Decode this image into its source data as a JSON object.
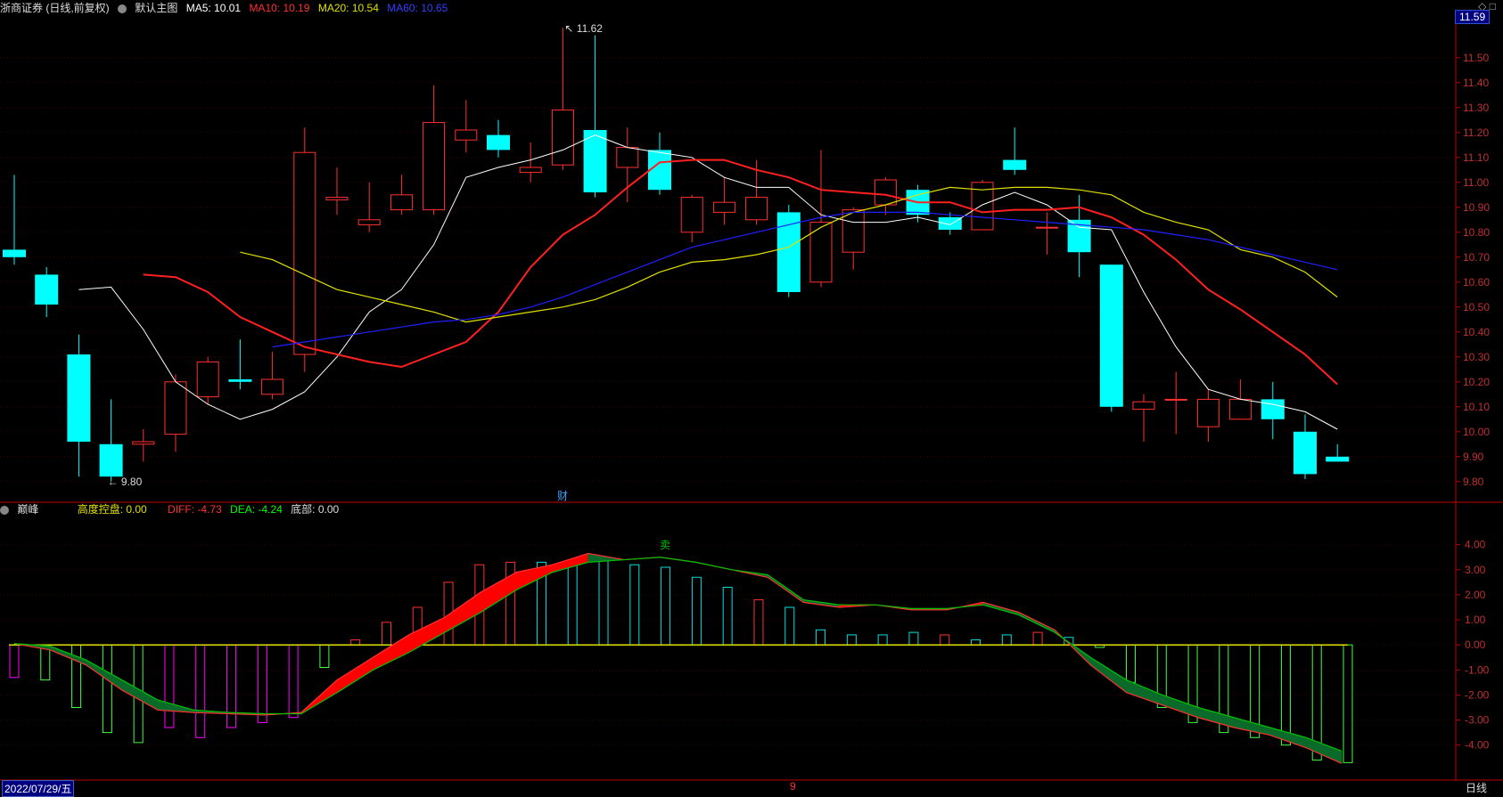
{
  "header": {
    "stock": "浙商证券 (日线,前复权)",
    "gear1": "gear-icon",
    "template": "默认主图",
    "ma5": "MA5: 10.01",
    "ma10": "MA10: 10.19",
    "ma20": "MA20: 10.54",
    "ma60": "MA60: 10.65"
  },
  "indicator_header": {
    "name": "巅峰",
    "gkp": "高度控盘: 0.00",
    "diff": "DIFF: -4.73",
    "dea": "DEA: -4.24",
    "bottom": "底部: 0.00"
  },
  "footer": {
    "date": "2022/07/29/五",
    "month_mark": "9",
    "period": "日线"
  },
  "annotations": {
    "high": "11.62",
    "low": "9.80",
    "cai": "财",
    "mai": "卖"
  },
  "price_badge": "11.59",
  "colors": {
    "up": "#ff3030",
    "down": "#00ffff",
    "ma5": "#ffffff",
    "ma10": "#ff2020",
    "ma20": "#e0e000",
    "ma60": "#2020ff",
    "diff": "#ff3030",
    "dea": "#00c000",
    "fill_up": "#ff0000",
    "fill_down": "#0a6a2a",
    "axis": "#c00000"
  },
  "chart_data": [
    {
      "type": "candlestick",
      "yticks": [
        "11.50",
        "11.40",
        "11.30",
        "11.20",
        "11.10",
        "11.00",
        "10.90",
        "10.80",
        "10.70",
        "10.60",
        "10.50",
        "10.40",
        "10.30",
        "10.20",
        "10.10",
        "10.00",
        "9.90",
        "9.80"
      ],
      "ylim": [
        9.76,
        11.66
      ],
      "candles": [
        {
          "o": 10.73,
          "c": 10.7,
          "h": 11.03,
          "l": 10.67
        },
        {
          "o": 10.63,
          "c": 10.51,
          "h": 10.66,
          "l": 10.46
        },
        {
          "o": 10.31,
          "c": 9.96,
          "h": 10.39,
          "l": 9.82
        },
        {
          "o": 9.95,
          "c": 9.82,
          "h": 10.13,
          "l": 9.8
        },
        {
          "o": 9.95,
          "c": 9.96,
          "h": 10.01,
          "l": 9.88
        },
        {
          "o": 9.99,
          "c": 10.2,
          "h": 10.23,
          "l": 9.92
        },
        {
          "o": 10.14,
          "c": 10.28,
          "h": 10.3,
          "l": 10.11
        },
        {
          "o": 10.21,
          "c": 10.2,
          "h": 10.37,
          "l": 10.17
        },
        {
          "o": 10.15,
          "c": 10.21,
          "h": 10.32,
          "l": 10.13
        },
        {
          "o": 10.31,
          "c": 11.12,
          "h": 11.22,
          "l": 10.24
        },
        {
          "o": 10.93,
          "c": 10.94,
          "h": 11.06,
          "l": 10.87
        },
        {
          "o": 10.83,
          "c": 10.85,
          "h": 11.0,
          "l": 10.8
        },
        {
          "o": 10.89,
          "c": 10.95,
          "h": 11.03,
          "l": 10.87
        },
        {
          "o": 10.89,
          "c": 11.24,
          "h": 11.39,
          "l": 10.87
        },
        {
          "o": 11.17,
          "c": 11.21,
          "h": 11.33,
          "l": 11.12
        },
        {
          "o": 11.19,
          "c": 11.13,
          "h": 11.25,
          "l": 11.1
        },
        {
          "o": 11.04,
          "c": 11.06,
          "h": 11.16,
          "l": 11.0
        },
        {
          "o": 11.07,
          "c": 11.29,
          "h": 11.62,
          "l": 11.05
        },
        {
          "o": 11.21,
          "c": 10.96,
          "h": 11.59,
          "l": 10.94
        },
        {
          "o": 11.06,
          "c": 11.14,
          "h": 11.22,
          "l": 10.92
        },
        {
          "o": 11.13,
          "c": 10.97,
          "h": 11.2,
          "l": 10.95
        },
        {
          "o": 10.8,
          "c": 10.94,
          "h": 10.95,
          "l": 10.76
        },
        {
          "o": 10.88,
          "c": 10.92,
          "h": 11.02,
          "l": 10.83
        },
        {
          "o": 10.85,
          "c": 10.94,
          "h": 11.09,
          "l": 10.83
        },
        {
          "o": 10.88,
          "c": 10.56,
          "h": 10.91,
          "l": 10.54
        },
        {
          "o": 10.6,
          "c": 10.84,
          "h": 11.13,
          "l": 10.58
        },
        {
          "o": 10.72,
          "c": 10.89,
          "h": 10.9,
          "l": 10.65
        },
        {
          "o": 10.91,
          "c": 11.01,
          "h": 11.02,
          "l": 10.87
        },
        {
          "o": 10.97,
          "c": 10.87,
          "h": 10.99,
          "l": 10.84
        },
        {
          "o": 10.86,
          "c": 10.81,
          "h": 10.88,
          "l": 10.79
        },
        {
          "o": 10.81,
          "c": 11.0,
          "h": 11.01,
          "l": 10.81
        },
        {
          "o": 11.09,
          "c": 11.05,
          "h": 11.22,
          "l": 11.03
        },
        {
          "o": 10.82,
          "c": 10.82,
          "h": 10.88,
          "l": 10.71
        },
        {
          "o": 10.85,
          "c": 10.72,
          "h": 10.95,
          "l": 10.62
        },
        {
          "o": 10.67,
          "c": 10.1,
          "h": 10.67,
          "l": 10.08
        },
        {
          "o": 10.09,
          "c": 10.12,
          "h": 10.15,
          "l": 9.96
        },
        {
          "o": 10.13,
          "c": 10.13,
          "h": 10.24,
          "l": 9.99
        },
        {
          "o": 10.02,
          "c": 10.13,
          "h": 10.17,
          "l": 9.96
        },
        {
          "o": 10.05,
          "c": 10.13,
          "h": 10.21,
          "l": 10.05
        },
        {
          "o": 10.13,
          "c": 10.05,
          "h": 10.2,
          "l": 9.97
        },
        {
          "o": 10.0,
          "c": 9.83,
          "h": 10.07,
          "l": 9.81
        },
        {
          "o": 9.9,
          "c": 9.88,
          "h": 9.95,
          "l": 9.88
        }
      ],
      "series": [
        {
          "name": "MA5",
          "values": [
            10.57,
            10.58,
            10.41,
            10.2,
            10.11,
            10.05,
            10.09,
            10.16,
            10.3,
            10.48,
            10.57,
            10.75,
            11.02,
            11.06,
            11.09,
            11.13,
            11.19,
            11.14,
            11.12,
            11.1,
            11.02,
            10.98,
            10.98,
            10.87,
            10.84,
            10.84,
            10.86,
            10.83,
            10.91,
            10.96,
            10.91,
            10.82,
            10.81,
            10.56,
            10.34,
            10.17,
            10.13,
            10.11,
            10.08,
            10.01
          ]
        },
        {
          "name": "MA10",
          "values": [
            10.63,
            10.62,
            10.56,
            10.46,
            10.4,
            10.34,
            10.31,
            10.28,
            10.26,
            10.31,
            10.36,
            10.48,
            10.66,
            10.79,
            10.87,
            10.98,
            11.08,
            11.09,
            11.09,
            11.05,
            11.02,
            10.97,
            10.96,
            10.95,
            10.92,
            10.92,
            10.88,
            10.89,
            10.89,
            10.9,
            10.86,
            10.79,
            10.69,
            10.57,
            10.49,
            10.4,
            10.31,
            10.19
          ]
        },
        {
          "name": "MA20",
          "values": [
            10.72,
            10.69,
            10.63,
            10.57,
            10.54,
            10.51,
            10.48,
            10.44,
            10.46,
            10.48,
            10.5,
            10.53,
            10.58,
            10.64,
            10.68,
            10.69,
            10.71,
            10.74,
            10.82,
            10.88,
            10.91,
            10.95,
            10.98,
            10.97,
            10.98,
            10.98,
            10.97,
            10.95,
            10.88,
            10.84,
            10.81,
            10.73,
            10.7,
            10.64,
            10.54
          ]
        },
        {
          "name": "MA60",
          "values": [
            10.34,
            10.36,
            10.38,
            10.4,
            10.42,
            10.44,
            10.45,
            10.47,
            10.5,
            10.54,
            10.59,
            10.64,
            10.69,
            10.74,
            10.77,
            10.8,
            10.83,
            10.86,
            10.88,
            10.88,
            10.88,
            10.87,
            10.86,
            10.85,
            10.84,
            10.83,
            10.82,
            10.81,
            10.79,
            10.77,
            10.74,
            10.71,
            10.68,
            10.65
          ]
        }
      ]
    },
    {
      "type": "bar",
      "title": "巅峰",
      "yticks": [
        "4.00",
        "3.00",
        "2.00",
        "1.00",
        "0.00",
        "-1.00",
        "-2.00",
        "-3.00",
        "-4.00"
      ],
      "ylim": [
        -4.9,
        4.7
      ],
      "macd": [
        -1.3,
        -1.4,
        -2.5,
        -3.5,
        -3.9,
        -3.3,
        -3.7,
        -3.3,
        -3.1,
        -2.9,
        -0.9,
        0.2,
        0.9,
        1.5,
        2.5,
        3.2,
        3.3,
        3.3,
        3.3,
        3.4,
        3.2,
        3.1,
        2.7,
        2.3,
        1.8,
        1.5,
        0.6,
        0.4,
        0.4,
        0.5,
        0.4,
        0.2,
        0.4,
        0.5,
        0.3,
        -0.1,
        -1.5,
        -2.5,
        -3.1,
        -3.5,
        -3.7,
        -4.0,
        -4.6,
        -4.7
      ],
      "diff": [
        0.05,
        -0.2,
        -0.8,
        -1.8,
        -2.6,
        -2.7,
        -2.75,
        -2.8,
        -2.7,
        -1.4,
        -0.5,
        0.4,
        1.1,
        2.1,
        2.9,
        3.2,
        3.65,
        3.4,
        3.5,
        3.3,
        3.0,
        2.7,
        1.7,
        1.5,
        1.6,
        1.4,
        1.4,
        1.7,
        1.3,
        0.6,
        -0.8,
        -1.9,
        -2.4,
        -2.9,
        -3.3,
        -3.6,
        -4.1,
        -4.73
      ],
      "dea": [
        0.05,
        -0.05,
        -0.6,
        -1.4,
        -2.2,
        -2.6,
        -2.7,
        -2.75,
        -2.75,
        -1.9,
        -1.0,
        -0.3,
        0.5,
        1.3,
        2.2,
        2.9,
        3.3,
        3.4,
        3.5,
        3.3,
        3.0,
        2.8,
        1.8,
        1.6,
        1.6,
        1.45,
        1.45,
        1.6,
        1.2,
        0.5,
        -0.5,
        -1.4,
        -2.0,
        -2.5,
        -2.9,
        -3.3,
        -3.7,
        -4.24
      ]
    }
  ]
}
